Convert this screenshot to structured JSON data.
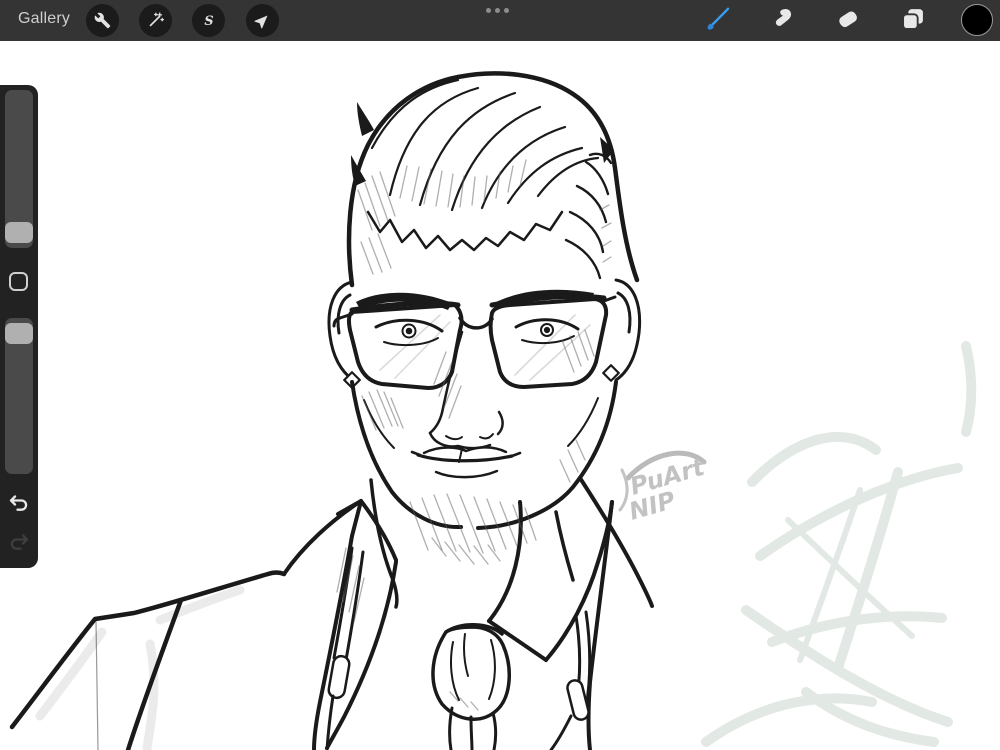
{
  "topbar": {
    "gallery_label": "Gallery",
    "left_tools": [
      {
        "name": "actions",
        "icon": "wrench-icon"
      },
      {
        "name": "adjustments",
        "icon": "magic-wand-icon"
      },
      {
        "name": "selection",
        "icon": "s-ribbon-icon",
        "glyph": "S"
      },
      {
        "name": "transform",
        "icon": "arrow-icon"
      }
    ],
    "center_handle": {
      "icon": "ellipsis-icon"
    },
    "right_tools": [
      {
        "name": "paint",
        "icon": "brush-icon",
        "active": true
      },
      {
        "name": "smudge",
        "icon": "smudge-icon",
        "active": false
      },
      {
        "name": "erase",
        "icon": "eraser-icon",
        "active": false
      },
      {
        "name": "layers",
        "icon": "layers-icon",
        "active": false
      },
      {
        "name": "color",
        "icon": "color-swatch",
        "swatch_color": "#000000"
      }
    ],
    "colors": {
      "bar_bg": "#343434",
      "button_bg": "#1b1b1b",
      "icon": "#e2e2e2",
      "active_accent": "#3b9df0"
    }
  },
  "sidebar": {
    "brush_size_slider": {
      "handle_position_pct_from_top": 85
    },
    "opacity_slider": {
      "handle_position_pct_from_top": 4
    },
    "undo": {
      "enabled": true
    },
    "redo": {
      "enabled": false
    },
    "colors": {
      "panel_bg": "#222222",
      "track": "#4a4a4a",
      "handle": "#b0b0b0"
    }
  },
  "canvas": {
    "background": "#ffffff",
    "artwork": {
      "ink_color": "#1a1a1a",
      "faint_sketch_color": "#dfe6e1",
      "signature_line1": "PuArt",
      "signature_line2": "NIP"
    }
  }
}
